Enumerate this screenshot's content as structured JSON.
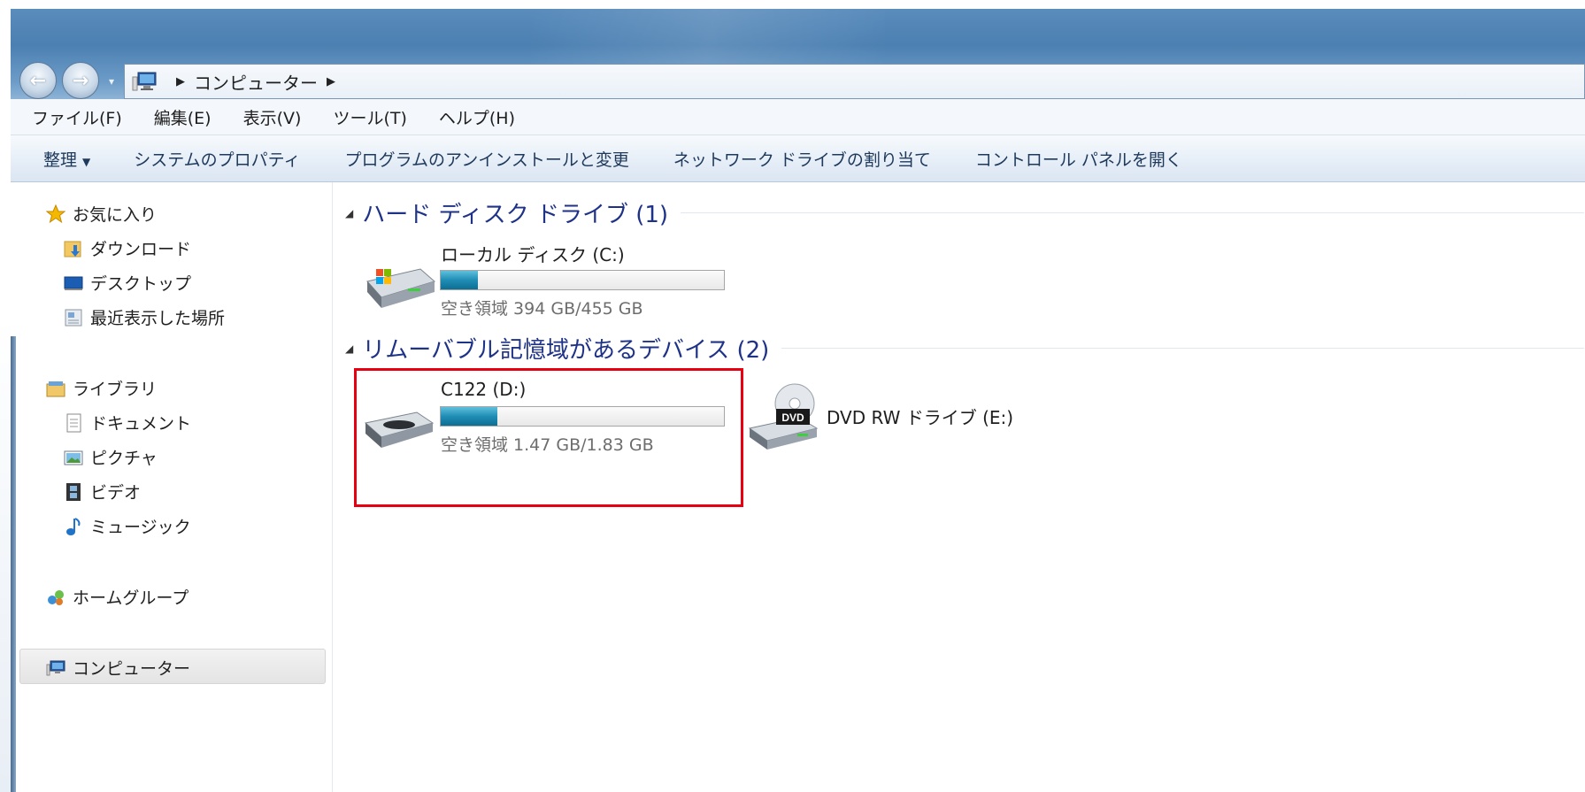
{
  "address": {
    "segments": [
      "コンピューター"
    ]
  },
  "menu": [
    "ファイル(F)",
    "編集(E)",
    "表示(V)",
    "ツール(T)",
    "ヘルプ(H)"
  ],
  "toolbar": [
    "整理",
    "システムのプロパティ",
    "プログラムのアンインストールと変更",
    "ネットワーク ドライブの割り当て",
    "コントロール パネルを開く"
  ],
  "nav": {
    "favorites": "お気に入り",
    "downloads": "ダウンロード",
    "desktop": "デスクトップ",
    "recent": "最近表示した場所",
    "libraries": "ライブラリ",
    "documents": "ドキュメント",
    "pictures": "ピクチャ",
    "videos": "ビデオ",
    "music": "ミュージック",
    "homegroup": "ホームグループ",
    "computer": "コンピューター"
  },
  "groups": {
    "hdd": "ハード ディスク ドライブ (1)",
    "removable": "リムーバブル記憶域があるデバイス (2)"
  },
  "drives": [
    {
      "name": "ローカル ディスク (C:)",
      "free": "空き領域 394 GB/455 GB",
      "used_fraction": 0.13
    },
    {
      "name": "C122 (D:)",
      "free": "空き領域 1.47 GB/1.83 GB",
      "used_fraction": 0.2
    },
    {
      "name": "DVD RW ドライブ (E:)"
    }
  ],
  "colors": {
    "highlight": "#e60012",
    "bar": "#1f8db5",
    "group_header": "#1e3287"
  },
  "icons": [
    "computer-icon",
    "star-icon",
    "download-folder-icon",
    "desktop-icon",
    "recent-places-icon",
    "library-icon",
    "document-icon",
    "picture-icon",
    "video-icon",
    "music-icon",
    "homegroup-icon",
    "windows-hdd-icon",
    "removable-drive-icon",
    "dvd-drive-icon"
  ]
}
